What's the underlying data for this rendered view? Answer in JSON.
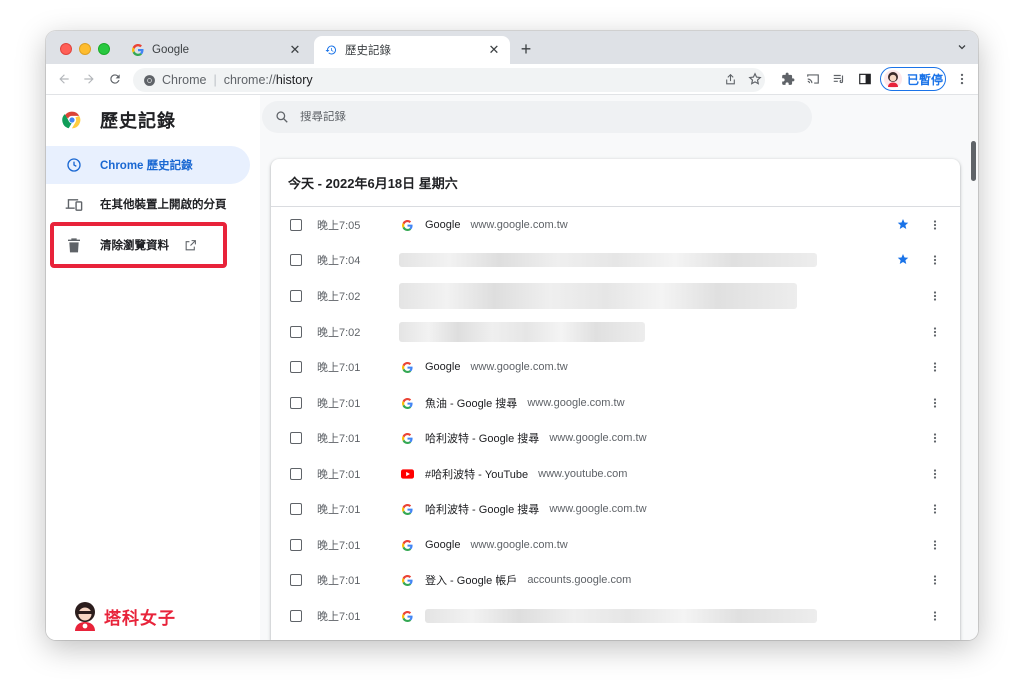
{
  "browser": {
    "tabs": [
      {
        "title": "Google",
        "active": false
      },
      {
        "title": "歷史記錄",
        "active": true
      }
    ],
    "omnibox": {
      "scheme_label": "Chrome",
      "url_host": "chrome://",
      "url_path": "history"
    },
    "profile_label": "已暫停"
  },
  "sidebar": {
    "title": "歷史記錄",
    "items": [
      {
        "label": "Chrome 歷史記錄",
        "selected": true,
        "icon": "clock-icon"
      },
      {
        "label": "在其他裝置上開啟的分頁",
        "selected": false,
        "icon": "devices-icon"
      },
      {
        "label": "清除瀏覽資料",
        "selected": false,
        "icon": "trash-icon"
      }
    ]
  },
  "watermark": "塔科女子",
  "search": {
    "placeholder": "搜尋記錄"
  },
  "history": {
    "date_header": "今天 - 2022年6月18日 星期六",
    "rows": [
      {
        "time": "晚上7:05",
        "favicon": "google",
        "title": "Google",
        "domain": "www.google.com.tw",
        "starred": true,
        "blurred": false
      },
      {
        "time": "晚上7:04",
        "favicon": "none",
        "title": "",
        "domain": "",
        "starred": true,
        "blurred": true
      },
      {
        "time": "晚上7:02",
        "favicon": "none",
        "title": "",
        "domain": "",
        "starred": false,
        "blurred": true
      },
      {
        "time": "晚上7:02",
        "favicon": "none",
        "title": "",
        "domain": "",
        "starred": false,
        "blurred": true
      },
      {
        "time": "晚上7:01",
        "favicon": "google",
        "title": "Google",
        "domain": "www.google.com.tw",
        "starred": false,
        "blurred": false
      },
      {
        "time": "晚上7:01",
        "favicon": "google",
        "title": "魚油 - Google 搜尋",
        "domain": "www.google.com.tw",
        "starred": false,
        "blurred": false
      },
      {
        "time": "晚上7:01",
        "favicon": "google",
        "title": "哈利波特 - Google 搜尋",
        "domain": "www.google.com.tw",
        "starred": false,
        "blurred": false
      },
      {
        "time": "晚上7:01",
        "favicon": "youtube",
        "title": "#哈利波特 - YouTube",
        "domain": "www.youtube.com",
        "starred": false,
        "blurred": false
      },
      {
        "time": "晚上7:01",
        "favicon": "google",
        "title": "哈利波特 - Google 搜尋",
        "domain": "www.google.com.tw",
        "starred": false,
        "blurred": false
      },
      {
        "time": "晚上7:01",
        "favicon": "google",
        "title": "Google",
        "domain": "www.google.com.tw",
        "starred": false,
        "blurred": false
      },
      {
        "time": "晚上7:01",
        "favicon": "google",
        "title": "登入 - Google 帳戶",
        "domain": "accounts.google.com",
        "starred": false,
        "blurred": false
      },
      {
        "time": "晚上7:01",
        "favicon": "google",
        "title": "",
        "domain": "",
        "starred": false,
        "blurred": true
      }
    ]
  },
  "colors": {
    "accent": "#1a73e8",
    "selected_bg": "#e8f0fe",
    "highlight": "#e8233a",
    "star": "#1a73e8"
  }
}
